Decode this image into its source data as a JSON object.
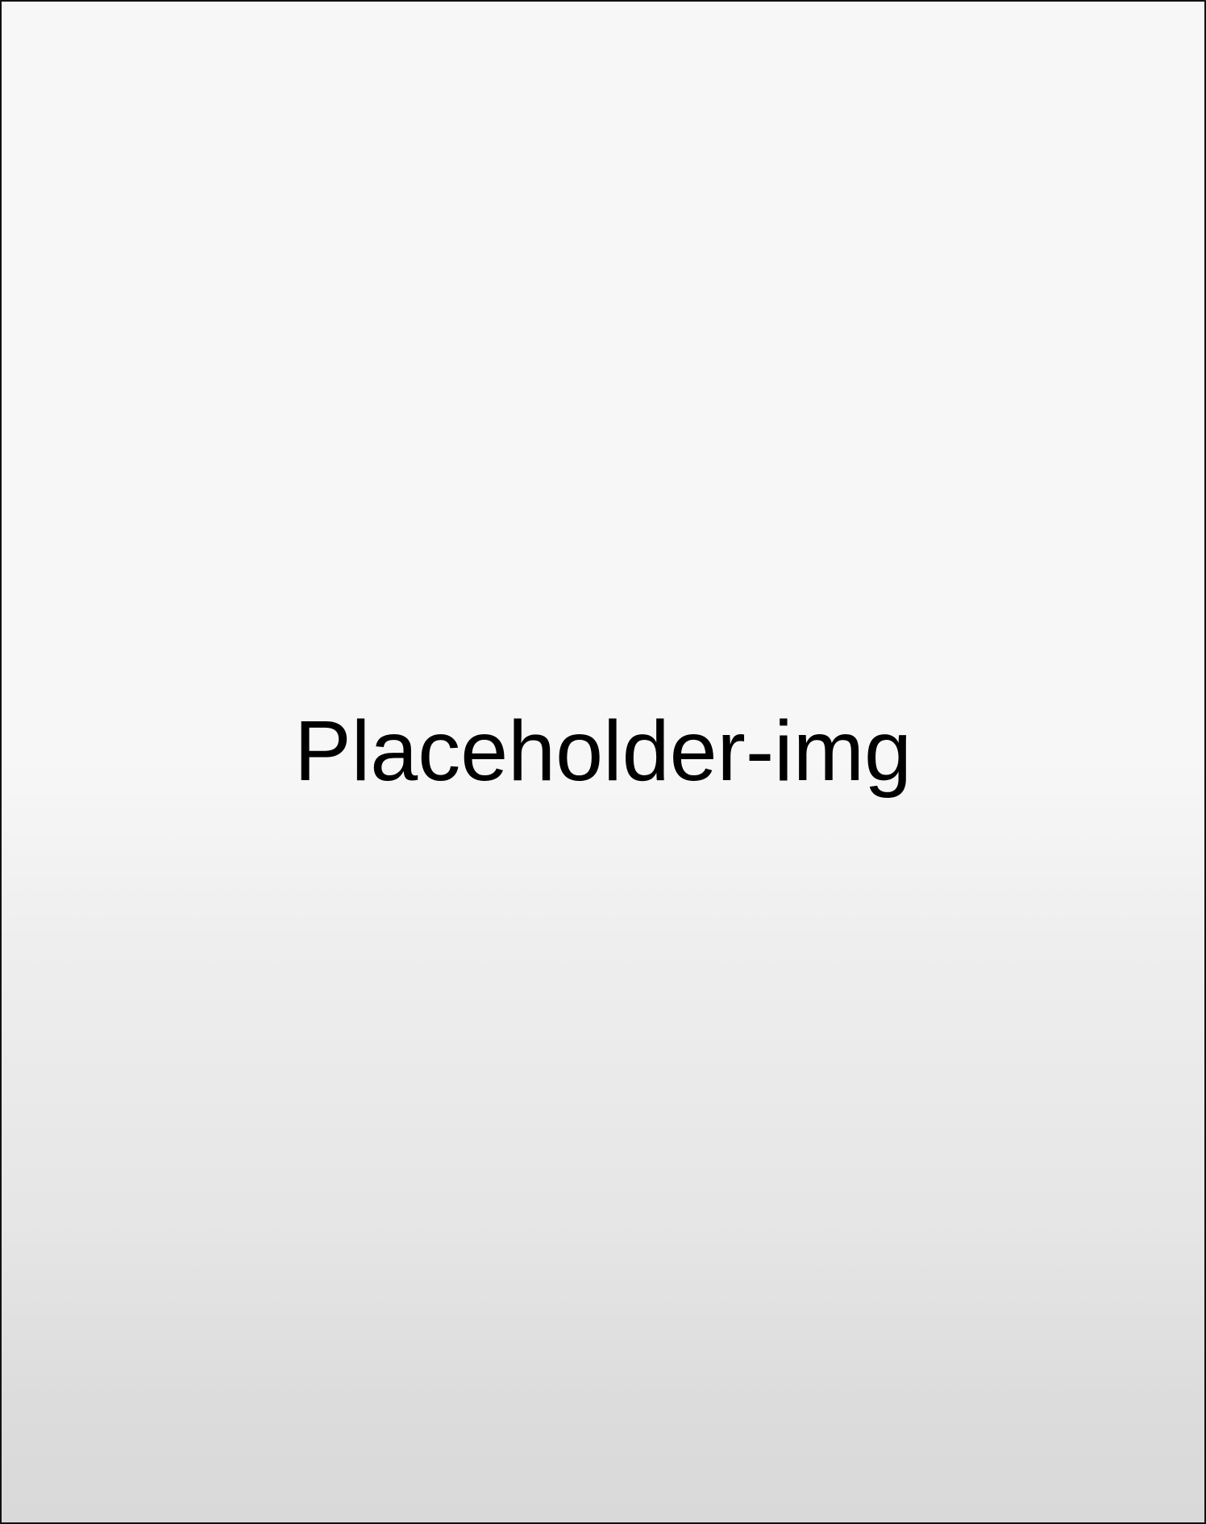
{
  "placeholder": {
    "label": "Placeholder-img"
  },
  "colors": {
    "border": "#111111",
    "background_top": "#f7f7f7",
    "background_bottom": "#d9d9d9",
    "text": "#000000"
  }
}
